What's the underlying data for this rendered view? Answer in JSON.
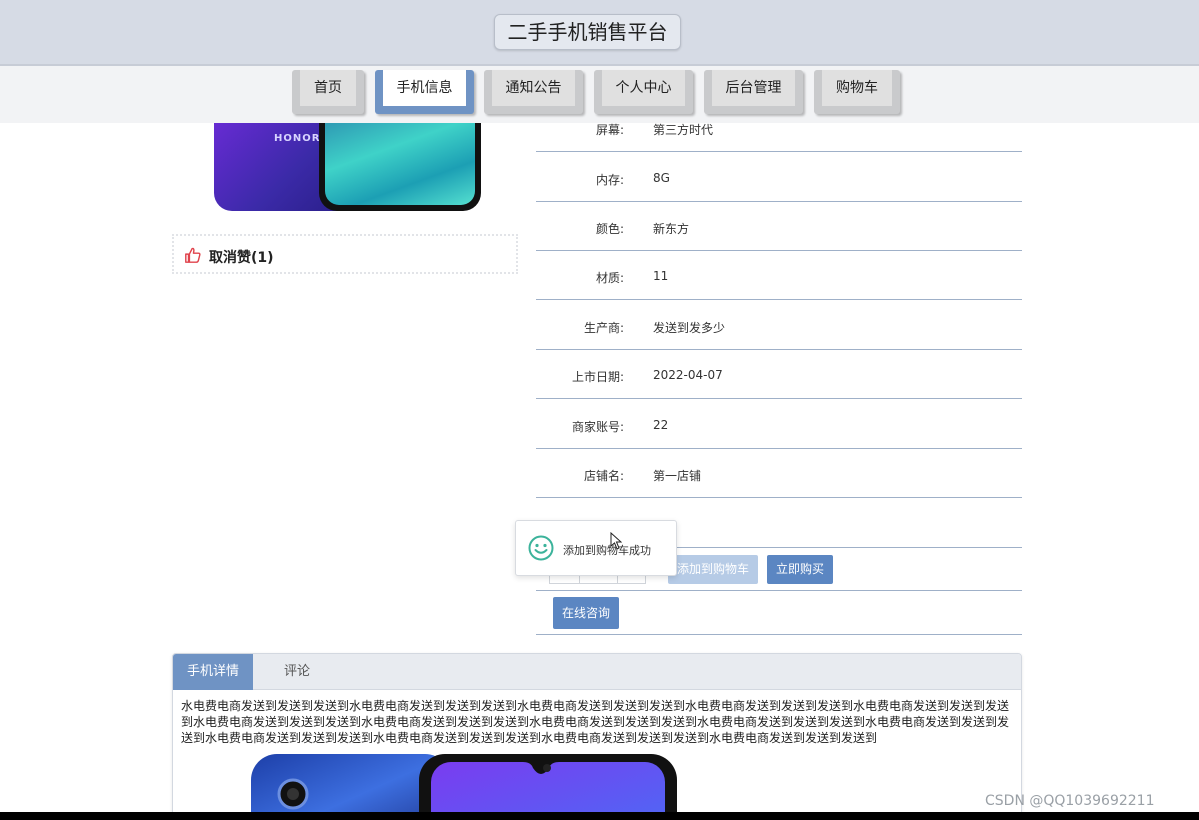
{
  "header": {
    "site_title": "二手手机销售平台"
  },
  "nav": {
    "items": [
      {
        "label": "首页"
      },
      {
        "label": "手机信息"
      },
      {
        "label": "通知公告"
      },
      {
        "label": "个人中心"
      },
      {
        "label": "后台管理"
      },
      {
        "label": "购物车"
      }
    ],
    "active": "手机信息"
  },
  "product": {
    "image_brand": "HONOR",
    "like_label": "取消赞(1)"
  },
  "specs": [
    {
      "label": "屏幕:",
      "value": "第三方时代"
    },
    {
      "label": "内存:",
      "value": "8G"
    },
    {
      "label": "颜色:",
      "value": "新东方"
    },
    {
      "label": "材质:",
      "value": "11"
    },
    {
      "label": "生产商:",
      "value": "发送到发多少"
    },
    {
      "label": "上市日期:",
      "value": "2022-04-07"
    },
    {
      "label": "商家账号:",
      "value": "22"
    },
    {
      "label": "店铺名:",
      "value": "第一店铺"
    }
  ],
  "actions": {
    "add_cart_label": "添加到购物车",
    "buy_now_label": "立即购买",
    "consult_label": "在线咨询"
  },
  "toast": {
    "message": "添加到购物车成功"
  },
  "detail": {
    "tabs": [
      {
        "label": "手机详情"
      },
      {
        "label": "评论"
      }
    ],
    "description": "水电费电商发送到发送到发送到水电费电商发送到发送到发送到水电费电商发送到发送到发送到水电费电商发送到发送到发送到水电费电商发送到发送到发送到水电费电商发送到发送到发送到水电费电商发送到发送到发送到水电费电商发送到发送到发送到水电费电商发送到发送到发送到水电费电商发送到发送到发送到水电费电商发送到发送到发送到水电费电商发送到发送到发送到水电费电商发送到发送到发送到水电费电商发送到发送到发送到"
  },
  "watermark": "CSDN @QQ1039692211",
  "colors": {
    "accent": "#5b86c2",
    "header_bg": "#d6dbe5",
    "toast_icon": "#3cb39b"
  }
}
